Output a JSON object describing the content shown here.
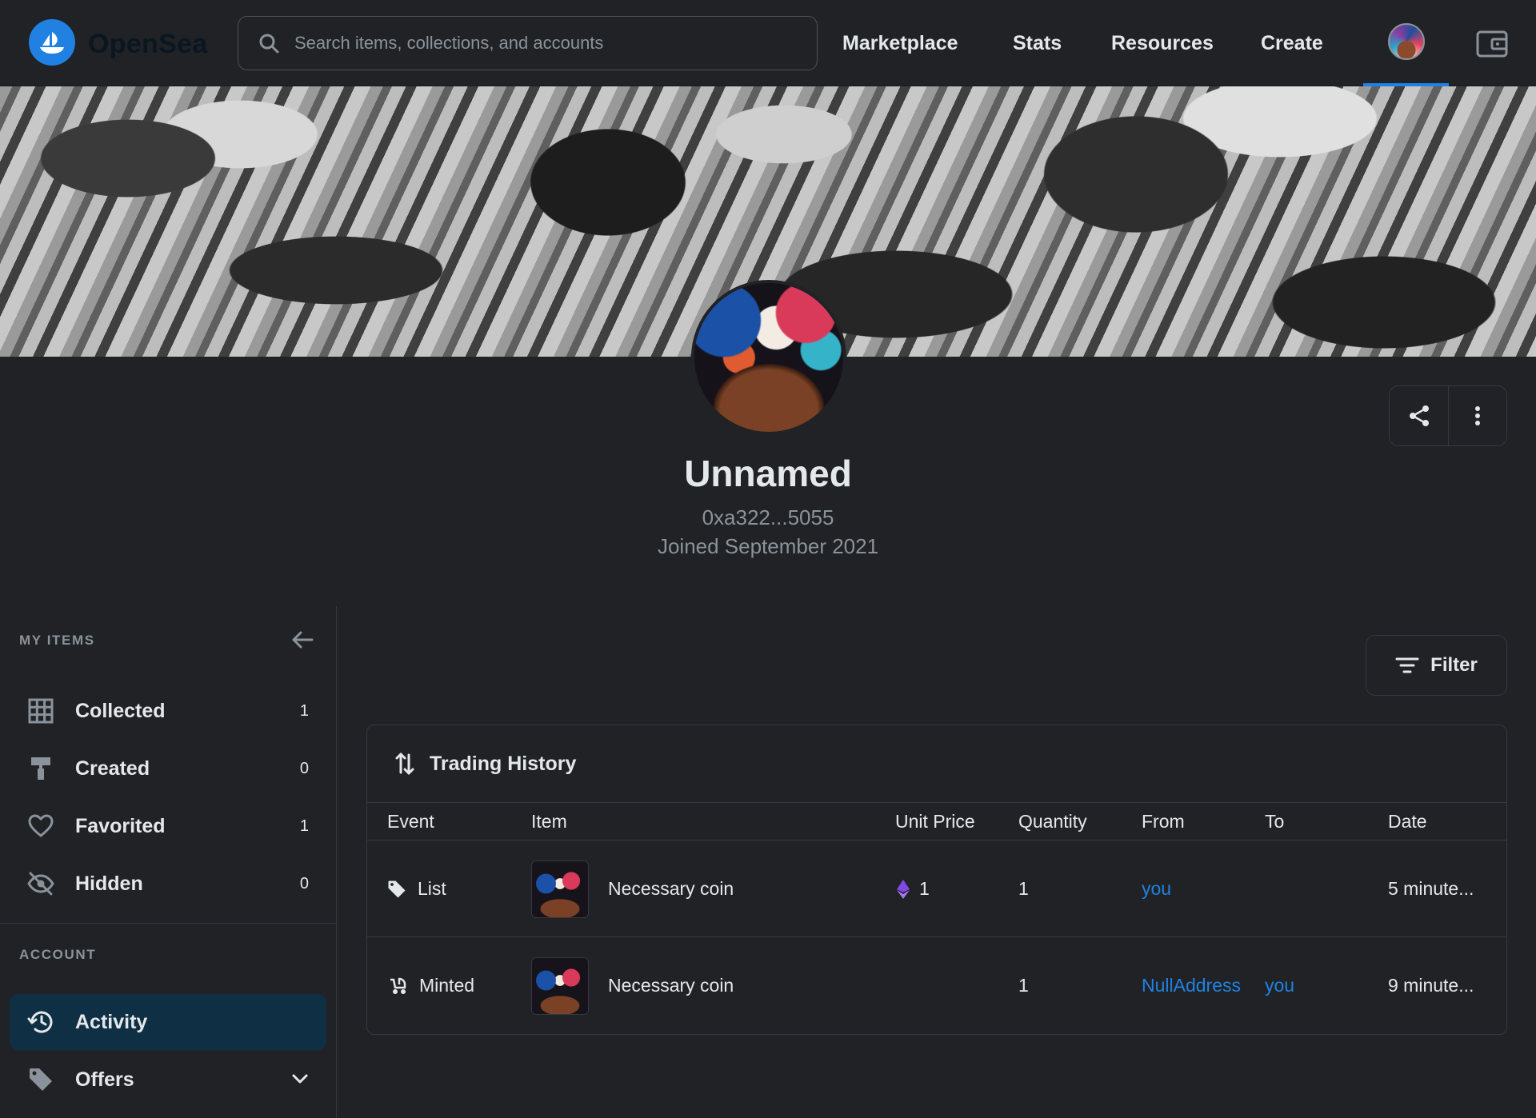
{
  "brand": {
    "name": "OpenSea"
  },
  "search": {
    "placeholder": "Search items, collections, and accounts"
  },
  "nav": {
    "marketplace": "Marketplace",
    "stats": "Stats",
    "resources": "Resources",
    "create": "Create"
  },
  "profile": {
    "name": "Unnamed",
    "address": "0xa322...5055",
    "joined": "Joined September 2021"
  },
  "sidebar": {
    "my_items_heading": "MY ITEMS",
    "items": [
      {
        "label": "Collected",
        "count": "1",
        "icon": "grid-icon"
      },
      {
        "label": "Created",
        "count": "0",
        "icon": "paint-roller-icon"
      },
      {
        "label": "Favorited",
        "count": "1",
        "icon": "heart-icon"
      },
      {
        "label": "Hidden",
        "count": "0",
        "icon": "eye-off-icon"
      }
    ],
    "account_heading": "ACCOUNT",
    "account_items": [
      {
        "label": "Activity",
        "icon": "history-icon",
        "active": true
      },
      {
        "label": "Offers",
        "icon": "tag-icon"
      }
    ]
  },
  "filter": {
    "label": "Filter"
  },
  "trading_history": {
    "title": "Trading History",
    "columns": [
      "Event",
      "Item",
      "Unit Price",
      "Quantity",
      "From",
      "To",
      "Date"
    ],
    "rows": [
      {
        "event": "List",
        "event_icon": "tag-icon",
        "item": "Necessary coin",
        "unit_price": "1",
        "price_icon": "ethereum-icon",
        "quantity": "1",
        "from": "you",
        "to": "",
        "date": "5 minute..."
      },
      {
        "event": "Minted",
        "event_icon": "baby-stroller-icon",
        "item": "Necessary coin",
        "unit_price": "",
        "quantity": "1",
        "from": "NullAddress",
        "to": "you",
        "date": "9 minute..."
      }
    ]
  },
  "colors": {
    "background": "#202225",
    "accent": "#2081e2",
    "active_item": "#0e2f44",
    "border": "#353840",
    "muted_text": "#8a939b"
  }
}
